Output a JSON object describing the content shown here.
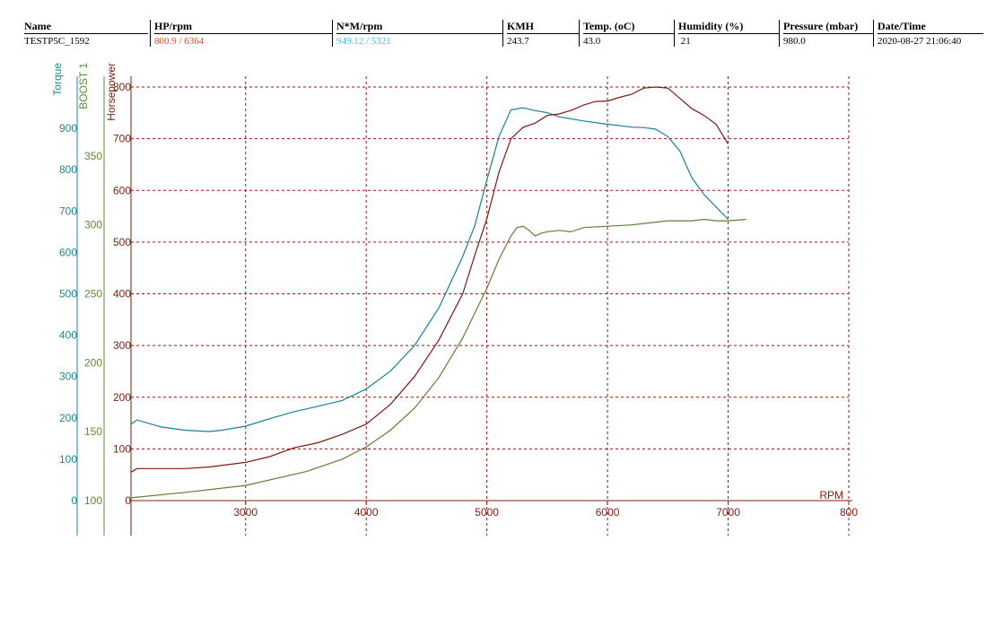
{
  "header": {
    "columns": [
      {
        "label": "Name",
        "value": "TESTP5C_1592",
        "color": "#000000"
      },
      {
        "label": "HP/rpm",
        "value": "800.9 / 6364",
        "color": "#e8461d"
      },
      {
        "label": "N*M/rpm",
        "value": "949.12 / 5321",
        "color": "#35c6ea"
      },
      {
        "label": "KMH",
        "value": "243.7",
        "color": "#000000"
      },
      {
        "label": "Temp. (oC)",
        "value": "43.0",
        "color": "#000000"
      },
      {
        "label": "Humidity (%)",
        "value": " 21",
        "color": "#000000"
      },
      {
        "label": "Pressure (mbar)",
        "value": "980.0",
        "color": "#000000"
      },
      {
        "label": "Date/Time",
        "value": "2020-08-27 21:06:40",
        "color": "#000000"
      }
    ]
  },
  "chart_data": {
    "type": "line",
    "xlabel": "RPM",
    "xlim": [
      2050,
      8000
    ],
    "xticks": [
      3000,
      4000,
      5000,
      6000,
      7000,
      8000
    ],
    "xtick_labels": [
      "3000",
      "4000",
      "5000",
      "6000",
      "7000",
      "800"
    ],
    "grid": true,
    "axes": [
      {
        "name": "Torque",
        "range": [
          0,
          1000
        ],
        "ticks": [
          0,
          100,
          200,
          300,
          400,
          500,
          600,
          700,
          800,
          900
        ],
        "color": "#1a8a98"
      },
      {
        "name": "BOOST 1",
        "range": [
          100,
          400
        ],
        "ticks": [
          100,
          150,
          200,
          250,
          300,
          350
        ],
        "color": "#5f8b35"
      },
      {
        "name": "Horsepower",
        "range": [
          0,
          800
        ],
        "ticks": [
          0,
          100,
          200,
          300,
          400,
          500,
          600,
          700
        ],
        "tick_labels": [
          "0",
          "100",
          "200",
          "300",
          "400",
          "500",
          "600",
          "700",
          "800"
        ],
        "color": "#7b1e12"
      }
    ],
    "series": [
      {
        "name": "Torque",
        "axis": 0,
        "color": "#1a7f9a",
        "x": [
          2050,
          2100,
          2300,
          2500,
          2700,
          2800,
          3000,
          3200,
          3400,
          3600,
          3800,
          4000,
          4200,
          4400,
          4600,
          4800,
          4900,
          5000,
          5100,
          5200,
          5300,
          5400,
          5500,
          5600,
          5800,
          6000,
          6200,
          6300,
          6400,
          6500,
          6600,
          6700,
          6800,
          6900,
          7000
        ],
        "y": [
          185,
          195,
          178,
          170,
          167,
          170,
          180,
          198,
          215,
          228,
          242,
          270,
          313,
          375,
          465,
          590,
          665,
          775,
          880,
          945,
          950,
          943,
          938,
          928,
          918,
          910,
          903,
          902,
          898,
          880,
          845,
          780,
          740,
          710,
          680
        ]
      },
      {
        "name": "BOOST 1",
        "axis": 1,
        "color": "#5f7f35",
        "x": [
          2050,
          2500,
          3000,
          3500,
          3800,
          4000,
          4200,
          4400,
          4600,
          4800,
          5000,
          5100,
          5200,
          5250,
          5300,
          5350,
          5400,
          5450,
          5500,
          5600,
          5700,
          5800,
          6000,
          6200,
          6400,
          6500,
          6600,
          6700,
          6800,
          6900,
          7000,
          7150
        ],
        "y": [
          102,
          106,
          111,
          121,
          130,
          139,
          151,
          167,
          189,
          218,
          254,
          275,
          292,
          298,
          299,
          296,
          292,
          294,
          295,
          296,
          295,
          298,
          299,
          300,
          302,
          303,
          303,
          303,
          304,
          303,
          303,
          304
        ]
      },
      {
        "name": "Horsepower",
        "axis": 2,
        "color": "#7d1a10",
        "x": [
          2050,
          2100,
          2300,
          2500,
          2700,
          3000,
          3200,
          3400,
          3600,
          3800,
          4000,
          4200,
          4400,
          4600,
          4800,
          4900,
          5000,
          5100,
          5200,
          5300,
          5400,
          5500,
          5600,
          5700,
          5800,
          5900,
          6000,
          6100,
          6200,
          6300,
          6400,
          6500,
          6600,
          6700,
          6800,
          6900,
          7000
        ],
        "y": [
          55,
          62,
          62,
          62,
          65,
          74,
          85,
          102,
          112,
          128,
          148,
          186,
          240,
          310,
          400,
          475,
          545,
          635,
          700,
          722,
          730,
          745,
          748,
          755,
          765,
          772,
          773,
          780,
          786,
          798,
          800,
          798,
          778,
          758,
          745,
          728,
          690
        ]
      }
    ]
  }
}
